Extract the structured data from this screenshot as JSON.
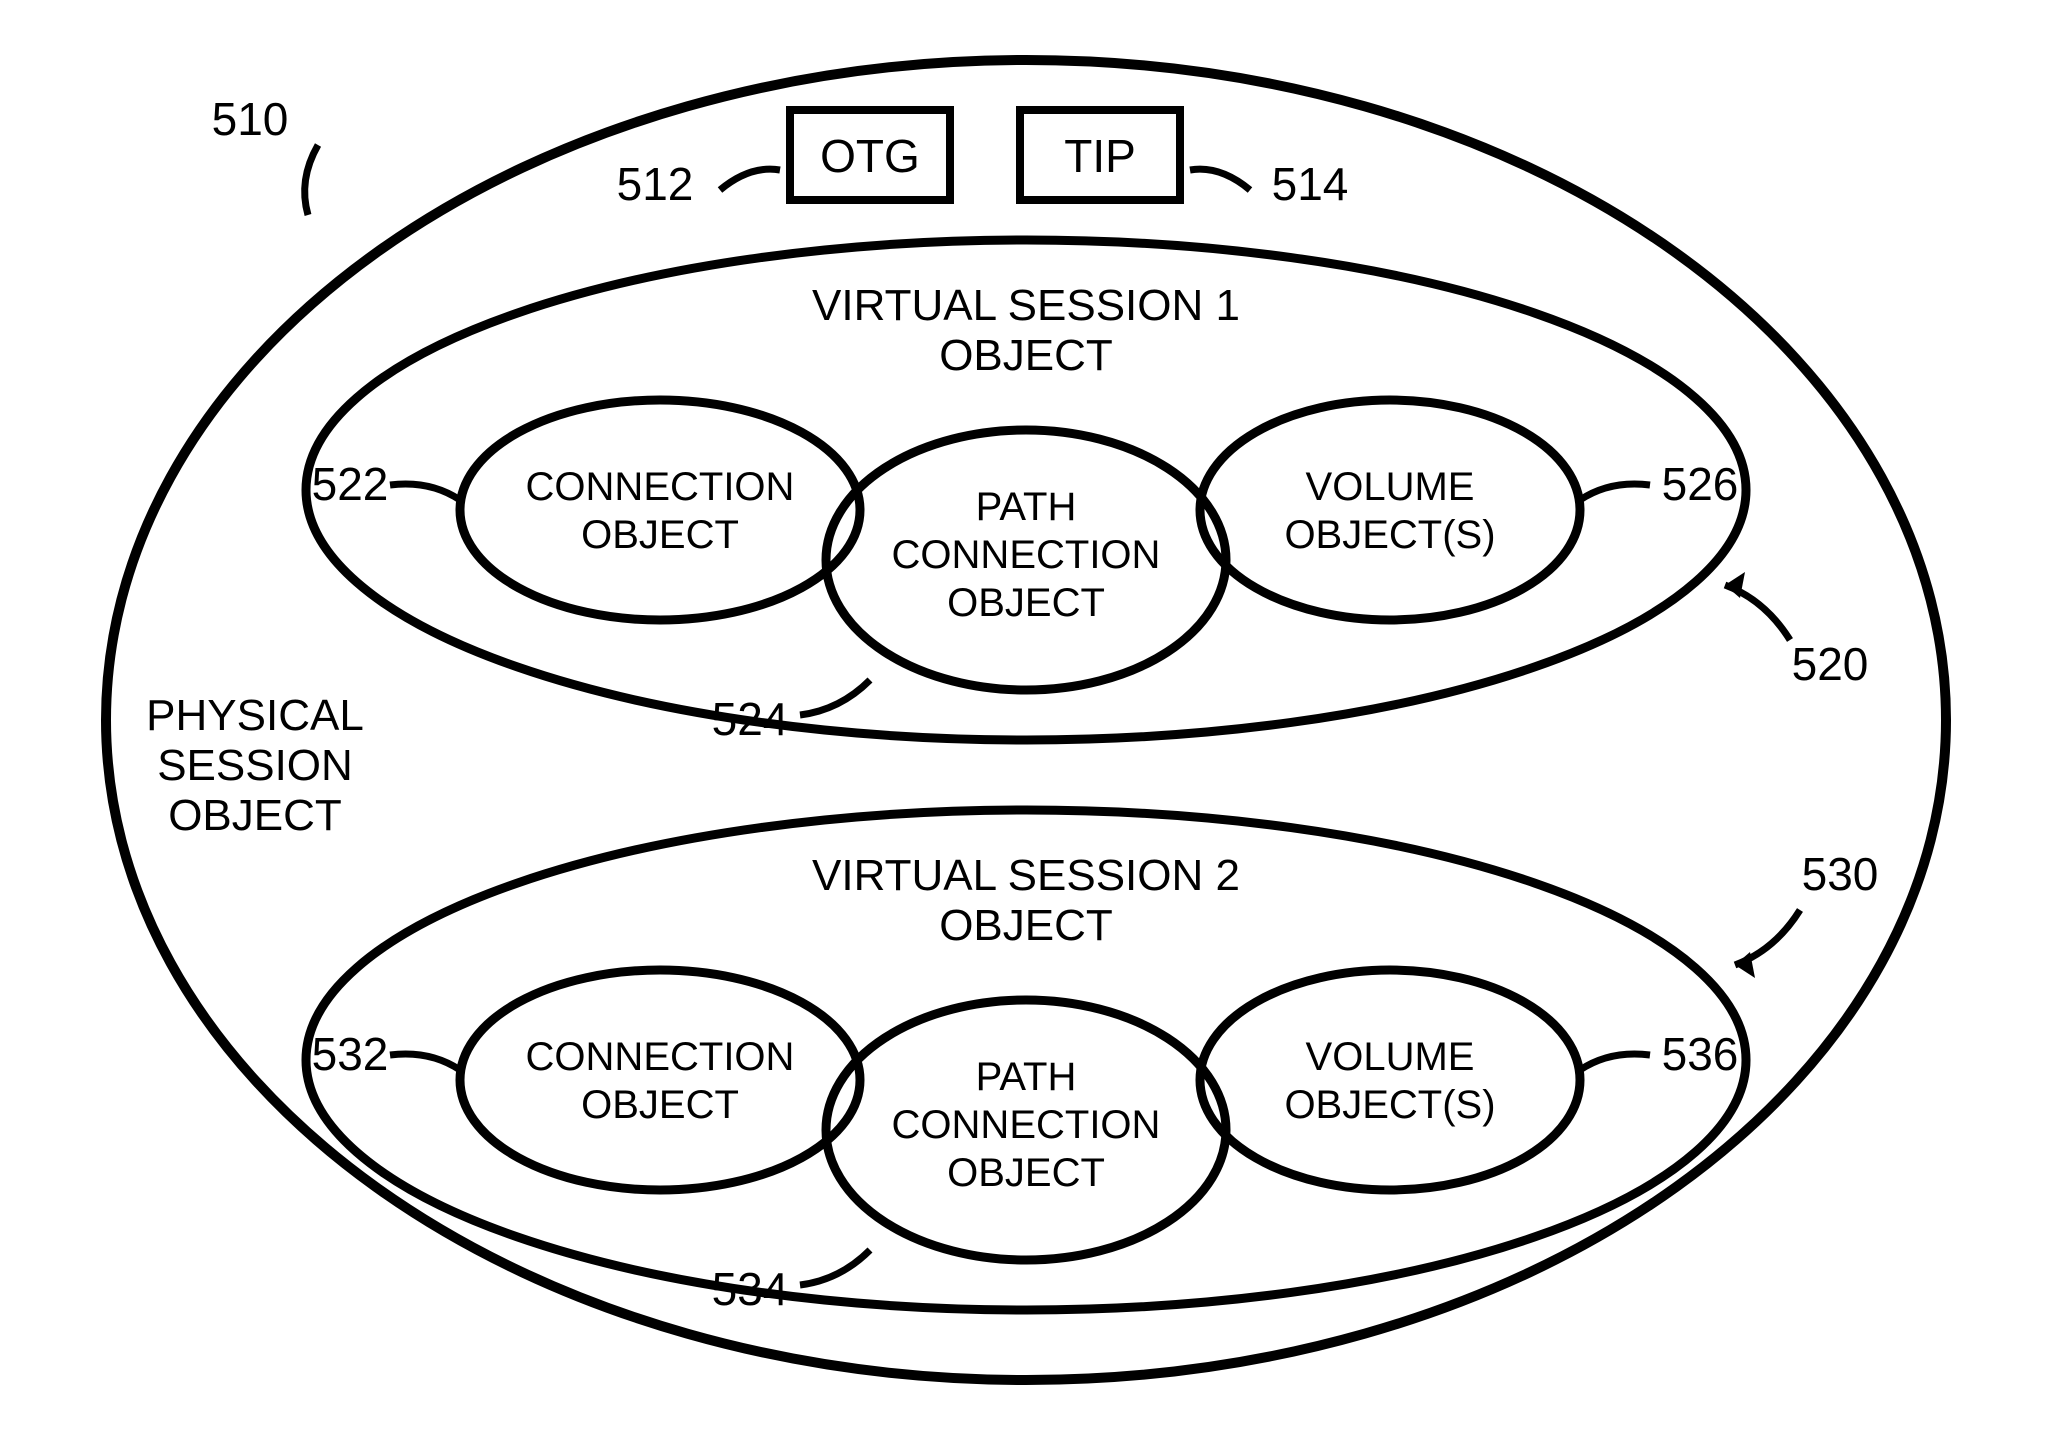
{
  "outer": {
    "title_l1": "PHYSICAL",
    "title_l2": "SESSION",
    "title_l3": "OBJECT",
    "ref": "510",
    "box1": {
      "label": "OTG",
      "ref": "512"
    },
    "box2": {
      "label": "TIP",
      "ref": "514"
    }
  },
  "vs1": {
    "title_l1": "VIRTUAL SESSION 1",
    "title_l2": "OBJECT",
    "ref": "520",
    "conn": {
      "l1": "CONNECTION",
      "l2": "OBJECT",
      "ref": "522"
    },
    "path": {
      "l1": "PATH",
      "l2": "CONNECTION",
      "l3": "OBJECT",
      "ref": "524"
    },
    "vol": {
      "l1": "VOLUME",
      "l2": "OBJECT(S)",
      "ref": "526"
    }
  },
  "vs2": {
    "title_l1": "VIRTUAL SESSION 2",
    "title_l2": "OBJECT",
    "ref": "530",
    "conn": {
      "l1": "CONNECTION",
      "l2": "OBJECT",
      "ref": "532"
    },
    "path": {
      "l1": "PATH",
      "l2": "CONNECTION",
      "l3": "OBJECT",
      "ref": "534"
    },
    "vol": {
      "l1": "VOLUME",
      "l2": "OBJECT(S)",
      "ref": "536"
    }
  }
}
